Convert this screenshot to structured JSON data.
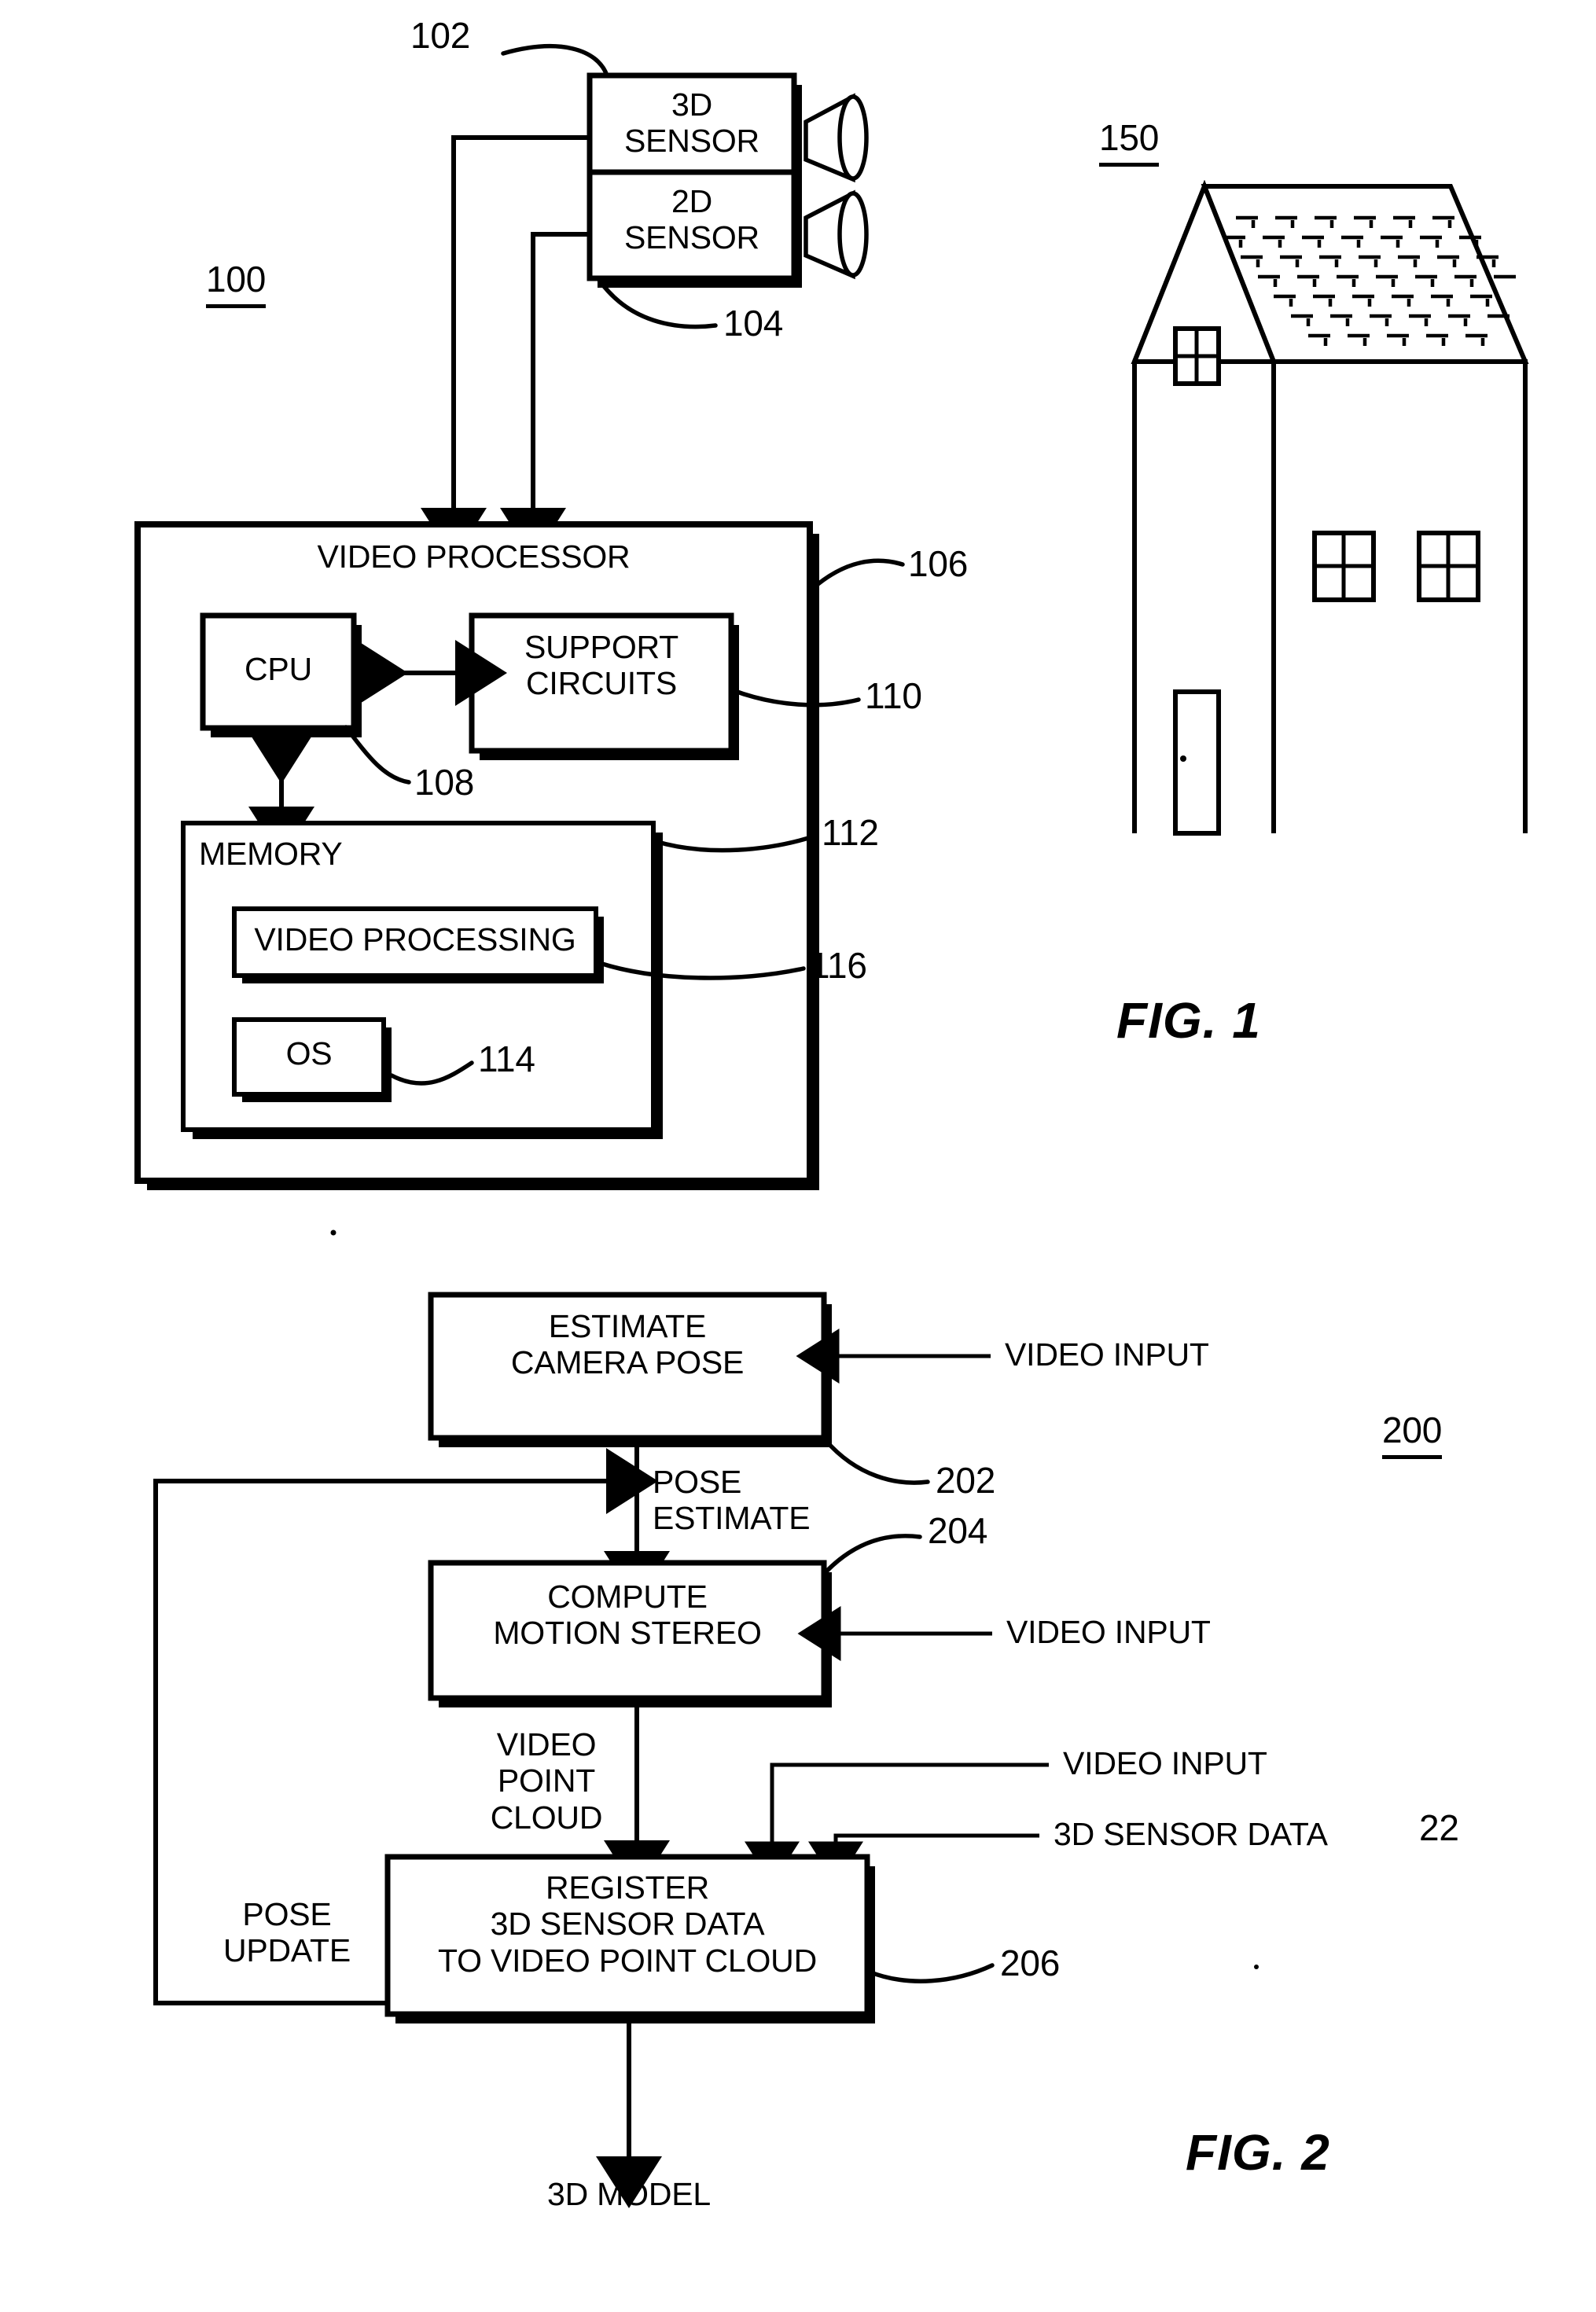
{
  "sheet": {
    "figures": [
      {
        "id": "fig1",
        "title": "FIG. 1",
        "system_ref": "100",
        "blocks": [
          {
            "name": "3d-sensor",
            "label": "3D\nSENSOR",
            "ref": "102"
          },
          {
            "name": "2d-sensor",
            "label": "2D\nSENSOR",
            "ref": "104"
          },
          {
            "name": "video-processor",
            "label": "VIDEO PROCESSOR",
            "ref": "106"
          },
          {
            "name": "cpu",
            "label": "CPU",
            "ref": "108"
          },
          {
            "name": "support-circuits",
            "label": "SUPPORT\nCIRCUITS",
            "ref": "110"
          },
          {
            "name": "memory",
            "label": "MEMORY",
            "ref": "112"
          },
          {
            "name": "video-processing",
            "label": "VIDEO PROCESSING",
            "ref": "116"
          },
          {
            "name": "os",
            "label": "OS",
            "ref": "114"
          }
        ],
        "scene": {
          "name": "house",
          "ref": "150"
        }
      },
      {
        "id": "fig2",
        "title": "FIG. 2",
        "system_ref": "200",
        "blocks": [
          {
            "name": "estimate-camera-pose",
            "label": "ESTIMATE\nCAMERA POSE",
            "ref": "202"
          },
          {
            "name": "compute-motion-stereo",
            "label": "COMPUTE\nMOTION STEREO",
            "ref": "204"
          },
          {
            "name": "register-3d-sensor-data",
            "label": "REGISTER\n3D SENSOR DATA\nTO VIDEO POINT CLOUD",
            "ref": "206"
          }
        ],
        "signals": {
          "video_input_1": "VIDEO INPUT",
          "video_input_2": "VIDEO INPUT",
          "video_input_3": "VIDEO INPUT",
          "sensor_data": "3D SENSOR DATA",
          "sensor_data_ref": "22",
          "pose_estimate": "POSE\nESTIMATE",
          "video_point_cloud": "VIDEO\nPOINT\nCLOUD",
          "pose_update": "POSE\nUPDATE",
          "output": "3D MODEL"
        }
      }
    ]
  },
  "fig1": {
    "ref_100": "100",
    "ref_102": "102",
    "ref_104": "104",
    "ref_106": "106",
    "ref_108": "108",
    "ref_110": "110",
    "ref_112": "112",
    "ref_114": "114",
    "ref_116": "116",
    "ref_150": "150",
    "sensor3d": "3D\nSENSOR",
    "sensor2d": "2D\nSENSOR",
    "video_processor": "VIDEO PROCESSOR",
    "cpu": "CPU",
    "support_circuits": "SUPPORT\nCIRCUITS",
    "memory": "MEMORY",
    "video_processing": "VIDEO PROCESSING",
    "os": "OS",
    "title": "FIG. 1"
  },
  "fig2": {
    "ref_200": "200",
    "ref_202": "202",
    "ref_204": "204",
    "ref_206": "206",
    "ref_22": "22",
    "estimate_camera_pose": "ESTIMATE\nCAMERA POSE",
    "compute_motion_stereo": "COMPUTE\nMOTION STEREO",
    "register_block": "REGISTER\n3D SENSOR DATA\nTO VIDEO POINT CLOUD",
    "video_input_1": "VIDEO INPUT",
    "video_input_2": "VIDEO INPUT",
    "video_input_3": "VIDEO INPUT",
    "sensor_data": "3D SENSOR DATA",
    "pose_estimate": "POSE\nESTIMATE",
    "video_point_cloud": "VIDEO\nPOINT\nCLOUD",
    "pose_update": "POSE\nUPDATE",
    "output_3d_model": "3D MODEL",
    "title": "FIG. 2"
  }
}
